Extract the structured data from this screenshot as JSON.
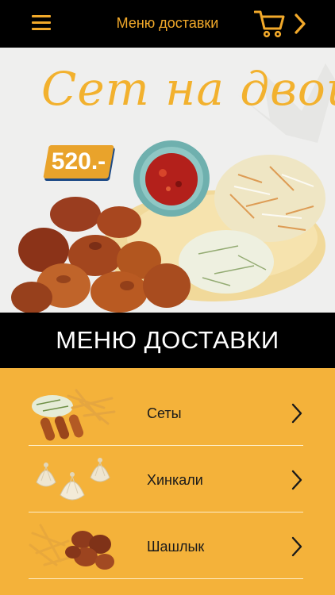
{
  "header": {
    "title": "Меню доставки",
    "menu_icon": "hamburger-menu-icon",
    "cart_icon": "shopping-cart-icon",
    "next_icon": "chevron-right-icon"
  },
  "banner": {
    "title": "Сет на двоих",
    "price": "520.-"
  },
  "section": {
    "title": "МЕНЮ ДОСТАВКИ"
  },
  "menu": {
    "items": [
      {
        "label": "Сеты"
      },
      {
        "label": "Хинкали"
      },
      {
        "label": "Шашлык"
      }
    ]
  },
  "colors": {
    "accent": "#f2a92a",
    "menu_bg": "#f4b23a",
    "bar_bg": "#000000"
  }
}
